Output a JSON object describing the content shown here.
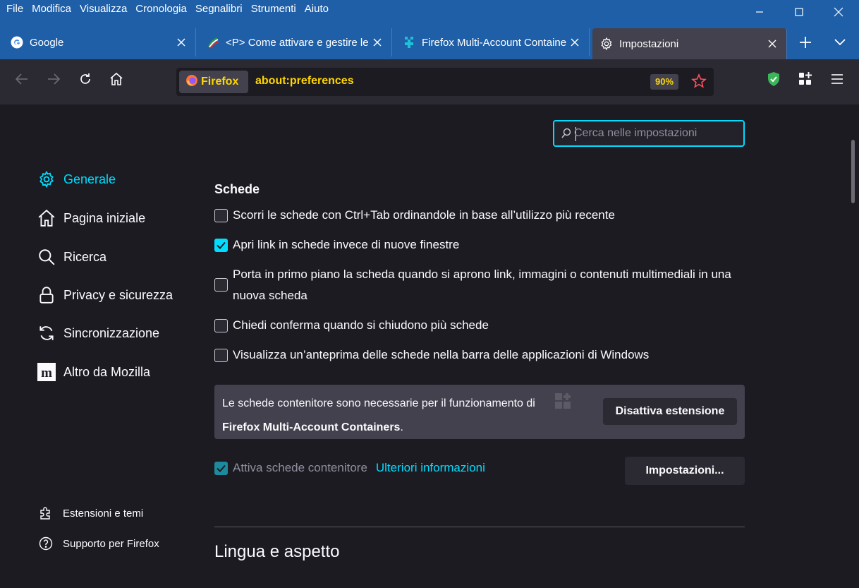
{
  "menu": [
    "File",
    "Modifica",
    "Visualizza",
    "Cronologia",
    "Segnalibri",
    "Strumenti",
    "Aiuto"
  ],
  "tabs": [
    {
      "label": "Google",
      "icon": "google-icon"
    },
    {
      "label": "<P> Come attivare e gestire le",
      "icon": "site-icon"
    },
    {
      "label": "Firefox Multi-Account Containers",
      "icon": "containers-icon"
    },
    {
      "label": "Impostazioni",
      "icon": "gear-icon"
    }
  ],
  "urlbar": {
    "identity_label": "Firefox",
    "url": "about:preferences",
    "zoom": "90%"
  },
  "search": {
    "placeholder": "Cerca nelle impostazioni"
  },
  "categories": [
    {
      "label": "Generale",
      "icon": "gear-icon",
      "selected": true
    },
    {
      "label": "Pagina iniziale",
      "icon": "home-icon"
    },
    {
      "label": "Ricerca",
      "icon": "search-icon"
    },
    {
      "label": "Privacy e sicurezza",
      "icon": "lock-icon"
    },
    {
      "label": "Sincronizzazione",
      "icon": "sync-icon"
    },
    {
      "label": "Altro da Mozilla",
      "icon": "mozilla-icon"
    }
  ],
  "footer": [
    {
      "label": "Estensioni e temi",
      "icon": "puzzle-icon"
    },
    {
      "label": "Supporto per Firefox",
      "icon": "help-icon"
    }
  ],
  "tabs_section": {
    "heading": "Schede",
    "options": [
      {
        "label": "Scorri le schede con Ctrl+Tab ordinandole in base all’utilizzo più recente",
        "checked": false
      },
      {
        "label": "Apri link in schede invece di nuove finestre",
        "checked": true
      },
      {
        "label": "Porta in primo piano la scheda quando si aprono link, immagini o contenuti multimediali in una",
        "label_line2": "nuova scheda",
        "checked": false
      },
      {
        "label": "Chiedi conferma quando si chiudono più schede",
        "checked": false
      },
      {
        "label": "Visualizza un’anteprima delle schede nella barra delle applicazioni di Windows",
        "checked": false
      }
    ],
    "notice": {
      "text": "Le schede contenitore sono necessarie per il funzionamento di",
      "extension": "Firefox Multi-Account Containers",
      "period": ".",
      "button": "Disattiva estensione"
    },
    "containers": {
      "label": "Attiva schede contenitore",
      "checked": true,
      "link": "Ulteriori informazioni",
      "settings_button": "Impostazioni..."
    }
  },
  "next_section": "Lingua e aspetto",
  "colors": {
    "accent": "#00ddff",
    "titlebar": "#1f5fa8",
    "url_highlight": "#ffd600"
  }
}
